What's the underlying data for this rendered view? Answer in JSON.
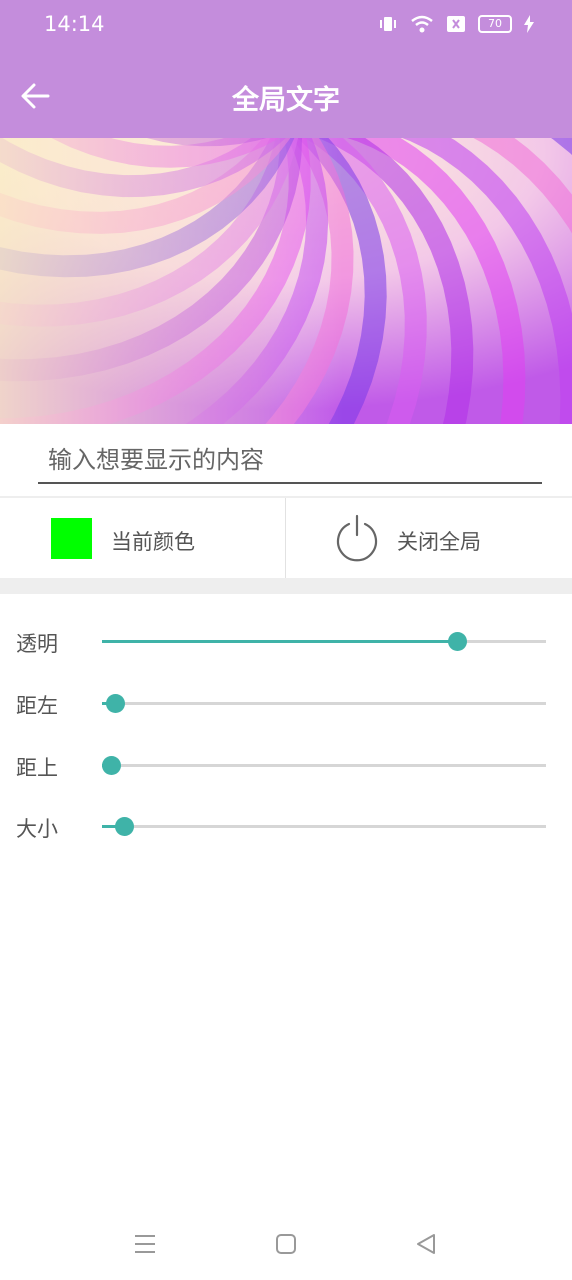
{
  "status_bar": {
    "time": "14:14",
    "battery": "70"
  },
  "app_bar": {
    "title": "全局文字"
  },
  "input": {
    "placeholder": "输入想要显示的内容",
    "value": ""
  },
  "options": {
    "current_color_label": "当前颜色",
    "current_color": "#00ff00",
    "close_global_label": "关闭全局"
  },
  "sliders": [
    {
      "label": "透明",
      "value_percent": 80
    },
    {
      "label": "距左",
      "value_percent": 3
    },
    {
      "label": "距上",
      "value_percent": 2
    },
    {
      "label": "大小",
      "value_percent": 5
    }
  ],
  "colors": {
    "primary": "#c48ddc",
    "accent": "#3fb3a8",
    "track": "#d6d6d6"
  }
}
